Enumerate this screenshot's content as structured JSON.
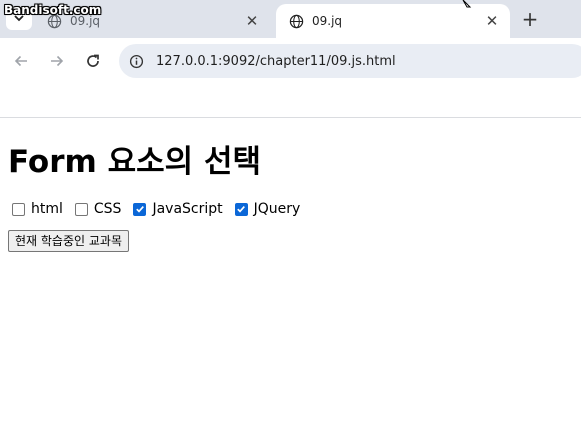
{
  "browser": {
    "watermark": "Bandisoft.com",
    "tabs": [
      {
        "title": "09.jq",
        "active": false
      },
      {
        "title": "09.jq",
        "active": true
      }
    ],
    "new_tab_label": "+",
    "close_glyph": "✕",
    "url": "127.0.0.1:9092/chapter11/09.js.html"
  },
  "page": {
    "heading": "Form 요소의 선택",
    "checkboxes": [
      {
        "label": "html",
        "checked": false
      },
      {
        "label": "CSS",
        "checked": false
      },
      {
        "label": "JavaScript",
        "checked": true
      },
      {
        "label": "JQuery",
        "checked": true
      }
    ],
    "button_label": "현재 학습중인 교과목"
  },
  "colors": {
    "tabbar_bg": "#dfe3eb",
    "omnibox_bg": "#e9edf4",
    "checkbox_checked": "#0b67d7"
  }
}
